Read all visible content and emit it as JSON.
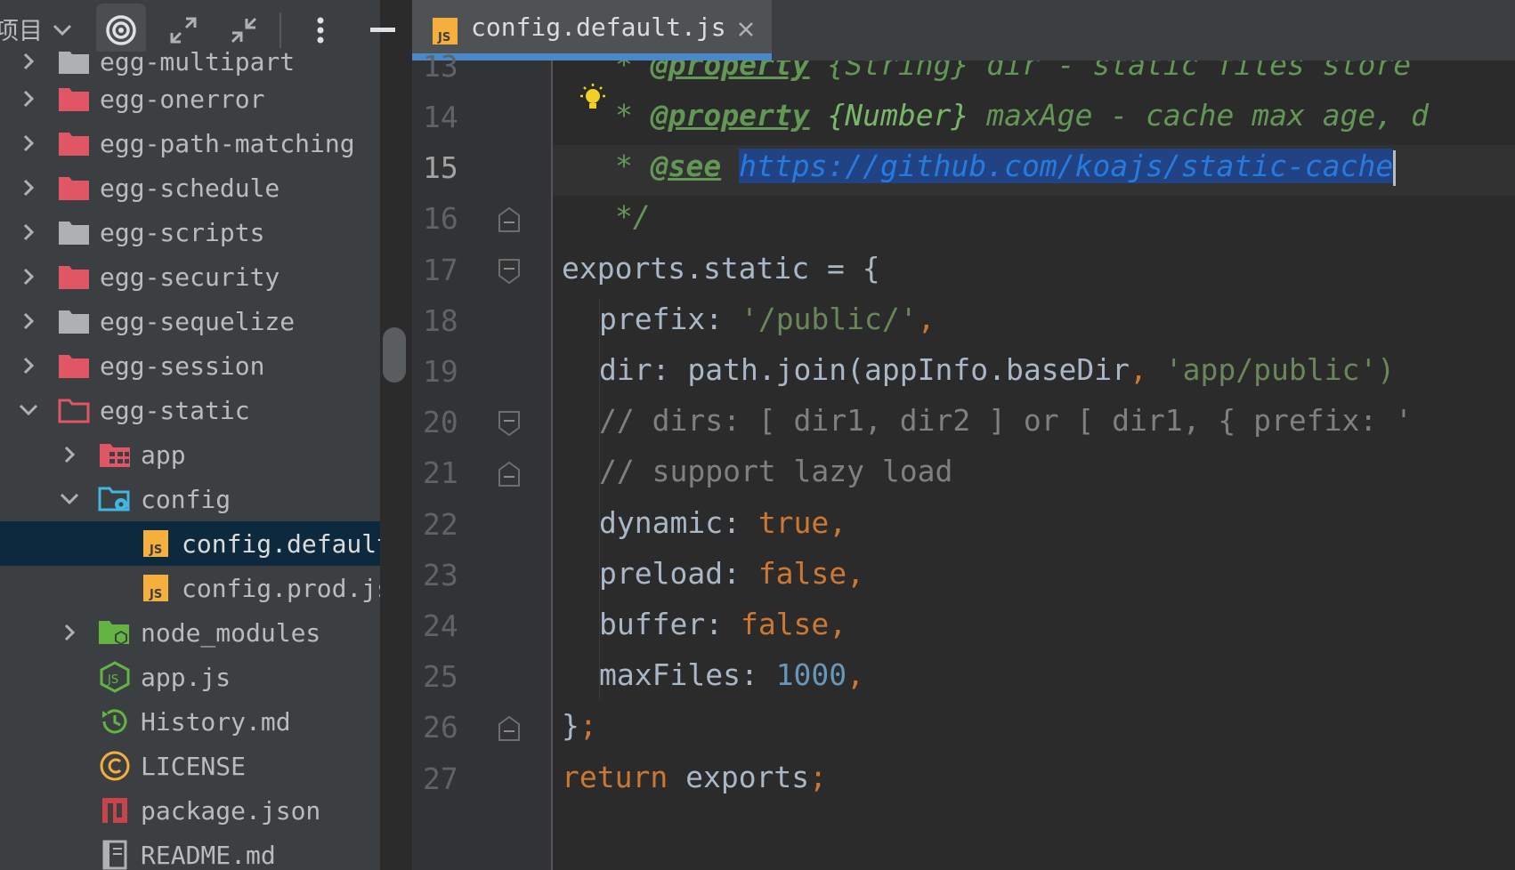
{
  "toolbar": {
    "project_label": "项目",
    "icons": [
      "chevron-down-icon",
      "target-icon",
      "expand-all-icon",
      "collapse-all-icon",
      "more-vertical-icon",
      "minimize-icon"
    ]
  },
  "tree": {
    "items": [
      {
        "label": "egg-multipart",
        "type": "folder",
        "state": "collapsed"
      },
      {
        "label": "egg-onerror",
        "type": "folder",
        "state": "collapsed"
      },
      {
        "label": "egg-path-matching",
        "type": "folder",
        "state": "collapsed"
      },
      {
        "label": "egg-schedule",
        "type": "folder",
        "state": "collapsed"
      },
      {
        "label": "egg-scripts",
        "type": "folder",
        "state": "collapsed"
      },
      {
        "label": "egg-security",
        "type": "folder",
        "state": "collapsed"
      },
      {
        "label": "egg-sequelize",
        "type": "folder",
        "state": "collapsed"
      },
      {
        "label": "egg-session",
        "type": "folder",
        "state": "collapsed"
      },
      {
        "label": "egg-static",
        "type": "folder",
        "state": "expanded"
      },
      {
        "label": "app",
        "type": "folder",
        "state": "collapsed"
      },
      {
        "label": "config",
        "type": "folder",
        "state": "expanded"
      },
      {
        "label": "config.default.js",
        "type": "js-file",
        "selected": true
      },
      {
        "label": "config.prod.js",
        "type": "js-file"
      },
      {
        "label": "node_modules",
        "type": "folder",
        "state": "collapsed"
      },
      {
        "label": "app.js",
        "type": "node-file"
      },
      {
        "label": "History.md",
        "type": "history-file"
      },
      {
        "label": "LICENSE",
        "type": "license-file"
      },
      {
        "label": "package.json",
        "type": "npm-file"
      },
      {
        "label": "README.md",
        "type": "markdown-file"
      }
    ]
  },
  "editor": {
    "tab": {
      "label": "config.default.js",
      "icon": "js-file-icon",
      "close": "×"
    },
    "lines": [
      {
        "num": "13",
        "parts": [
          {
            "t": "* ",
            "c": "doc-ital"
          },
          {
            "t": "@property",
            "c": "doc-tag"
          },
          {
            "t": " {String} dir - static files store",
            "c": "doc-ital"
          }
        ]
      },
      {
        "num": "14",
        "parts": [
          {
            "t": "* ",
            "c": "doc-ital"
          },
          {
            "t": "@property",
            "c": "doc-tag"
          },
          {
            "t": " ",
            "c": "doc-ital"
          },
          {
            "t": "{Number}",
            "c": "doc-type"
          },
          {
            "t": " maxAge - cache max age, d",
            "c": "doc-ital"
          }
        ]
      },
      {
        "num": "15",
        "parts": [
          {
            "t": "* ",
            "c": "doc-ital"
          },
          {
            "t": "@see",
            "c": "doc-tag"
          },
          {
            "t": " ",
            "c": "doc-ital"
          },
          {
            "t": "https://github.com/koajs/static-cache",
            "c": "link"
          }
        ]
      },
      {
        "num": "16",
        "parts": [
          {
            "t": "*/",
            "c": "doc-ital"
          }
        ]
      },
      {
        "num": "17",
        "parts": [
          {
            "t": "exports.static = {",
            "c": ""
          }
        ]
      },
      {
        "num": "18",
        "parts": [
          {
            "t": "prefix: ",
            "c": ""
          },
          {
            "t": "'/public/'",
            "c": "str"
          },
          {
            "t": ",",
            "c": "kw"
          }
        ]
      },
      {
        "num": "19",
        "parts": [
          {
            "t": "dir: path.join(appInfo.baseDir",
            "c": ""
          },
          {
            "t": ", ",
            "c": "kw"
          },
          {
            "t": "'app/public')",
            "c": "str"
          }
        ]
      },
      {
        "num": "20",
        "parts": [
          {
            "t": "// dirs: [ dir1, dir2 ] or [ dir1, { prefix: '",
            "c": "cmt"
          }
        ]
      },
      {
        "num": "21",
        "parts": [
          {
            "t": "// support lazy load",
            "c": "cmt"
          }
        ]
      },
      {
        "num": "22",
        "parts": [
          {
            "t": "dynamic: ",
            "c": ""
          },
          {
            "t": "true,",
            "c": "kw"
          }
        ]
      },
      {
        "num": "23",
        "parts": [
          {
            "t": "preload: ",
            "c": ""
          },
          {
            "t": "false,",
            "c": "kw"
          }
        ]
      },
      {
        "num": "24",
        "parts": [
          {
            "t": "buffer: ",
            "c": ""
          },
          {
            "t": "false,",
            "c": "kw"
          }
        ]
      },
      {
        "num": "25",
        "parts": [
          {
            "t": "maxFiles: ",
            "c": ""
          },
          {
            "t": "1000",
            "c": "num"
          },
          {
            "t": ",",
            "c": "kw"
          }
        ]
      },
      {
        "num": "26",
        "parts": [
          {
            "t": "}",
            "c": ""
          },
          {
            "t": ";",
            "c": "kw"
          }
        ]
      },
      {
        "num": "27",
        "parts": [
          {
            "t": "return",
            "c": "kw"
          },
          {
            "t": " exports",
            "c": ""
          },
          {
            "t": ";",
            "c": "kw"
          }
        ]
      }
    ],
    "current_line": "15",
    "colors": {
      "selection": "#214283",
      "doc_comment": "#629755",
      "keyword": "#cc7832",
      "string": "#6a8759",
      "number": "#6897bb",
      "link": "#287bde"
    }
  }
}
